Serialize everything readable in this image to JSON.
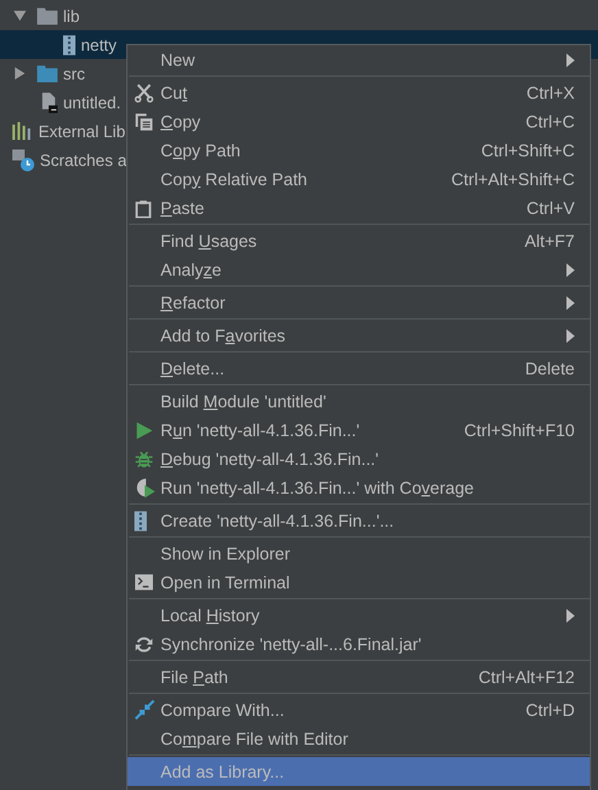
{
  "tree": [
    {
      "label": "lib",
      "kind": "folder",
      "expanded": true,
      "arrow": true,
      "depth_children": [
        {
          "label": "netty",
          "kind": "jar",
          "selected": true
        }
      ]
    },
    {
      "label": "src",
      "kind": "source-folder",
      "expanded": false,
      "arrow": true
    },
    {
      "label": "untitled.",
      "kind": "module-file",
      "arrow": false
    },
    {
      "label": "External Lib",
      "kind": "libraries",
      "arrow": false
    },
    {
      "label": "Scratches a",
      "kind": "scratches",
      "arrow": false
    }
  ],
  "context_menu": {
    "groups": [
      [
        {
          "label": "New",
          "submenu": true,
          "selected": false
        }
      ],
      [
        {
          "label": {
            "before": "Cu",
            "underlined": "t"
          },
          "shortcut": "Ctrl+X",
          "submenu": false,
          "selected": false
        },
        {
          "label": {
            "underlined": "C",
            "after": "opy"
          },
          "shortcut": "Ctrl+C",
          "submenu": false,
          "selected": false
        },
        {
          "label": {
            "before": "C",
            "underlined": "o",
            "after": "py Path"
          },
          "shortcut": "Ctrl+Shift+C",
          "submenu": false,
          "selected": false
        },
        {
          "label": {
            "before": "Cop",
            "underlined": "y",
            "after": " Relative Path"
          },
          "shortcut": "Ctrl+Alt+Shift+C",
          "submenu": false,
          "selected": false
        },
        {
          "label": {
            "underlined": "P",
            "after": "aste"
          },
          "shortcut": "Ctrl+V",
          "submenu": false,
          "selected": false
        }
      ],
      [
        {
          "label": {
            "before": "Find ",
            "underlined": "U",
            "after": "sages"
          },
          "shortcut": "Alt+F7",
          "submenu": false,
          "selected": false
        },
        {
          "label": {
            "before": "Analy",
            "underlined": "z",
            "after": "e"
          },
          "submenu": true,
          "selected": false
        }
      ],
      [
        {
          "label": {
            "underlined": "R",
            "after": "efactor"
          },
          "submenu": true,
          "selected": false
        }
      ],
      [
        {
          "label": {
            "before": "Add to F",
            "underlined": "a",
            "after": "vorites"
          },
          "submenu": true,
          "selected": false
        }
      ],
      [
        {
          "label": {
            "underlined": "D",
            "after": "elete..."
          },
          "shortcut": "Delete",
          "submenu": false,
          "selected": false
        }
      ],
      [
        {
          "label": {
            "before": "Build ",
            "underlined": "M",
            "after": "odule 'untitled'"
          },
          "submenu": false,
          "selected": false
        },
        {
          "label": {
            "before": "R",
            "underlined": "u",
            "after": "n 'netty-all-4.1.36.Fin...'"
          },
          "shortcut": "Ctrl+Shift+F10",
          "submenu": false,
          "selected": false
        },
        {
          "label": {
            "underlined": "D",
            "after": "ebug 'netty-all-4.1.36.Fin...'"
          },
          "submenu": false,
          "selected": false
        },
        {
          "label": {
            "before": "Run 'netty-all-4.1.36.Fin...' with Co",
            "underlined": "v",
            "after": "erage"
          },
          "submenu": false,
          "selected": false
        }
      ],
      [
        {
          "label": "Create 'netty-all-4.1.36.Fin...'...",
          "submenu": false,
          "selected": false
        }
      ],
      [
        {
          "label": "Show in Explorer",
          "submenu": false,
          "selected": false
        },
        {
          "label": "Open in Terminal",
          "submenu": false,
          "selected": false
        }
      ],
      [
        {
          "label": {
            "before": "Local ",
            "underlined": "H",
            "after": "istory"
          },
          "submenu": true,
          "selected": false
        },
        {
          "label": "Synchronize 'netty-all-...6.Final.jar'",
          "submenu": false,
          "selected": false
        }
      ],
      [
        {
          "label": {
            "before": "File ",
            "underlined": "P",
            "after": "ath"
          },
          "shortcut": "Ctrl+Alt+F12",
          "submenu": false,
          "selected": false
        }
      ],
      [
        {
          "label": "Compare With...",
          "shortcut": "Ctrl+D",
          "submenu": false,
          "selected": false
        },
        {
          "label": {
            "before": "Co",
            "underlined": "m",
            "after": "pare File with Editor"
          },
          "submenu": false,
          "selected": false
        }
      ],
      [
        {
          "label": "Add as Library...",
          "submenu": false,
          "selected": true
        }
      ]
    ]
  }
}
